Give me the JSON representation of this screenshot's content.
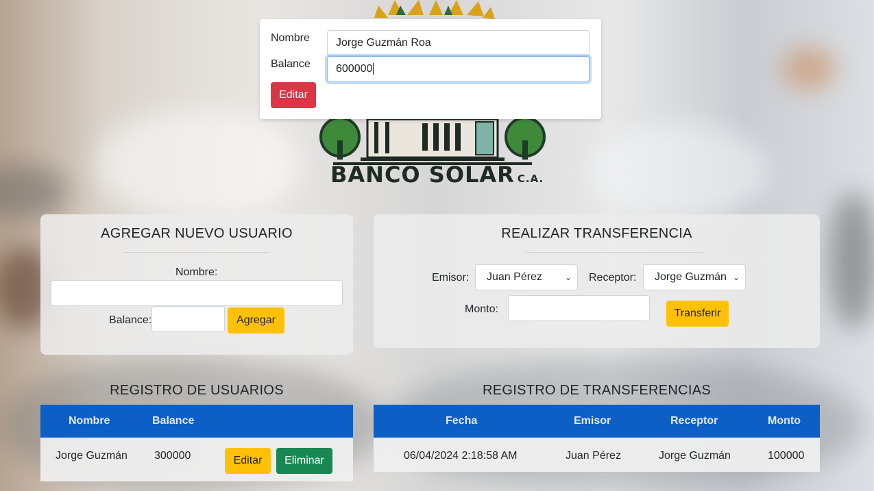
{
  "brand": {
    "logo_text": "BANCO SOLAR",
    "logo_suffix": "C.A."
  },
  "edit_modal": {
    "name_label": "Nombre",
    "name_value": "Jorge Guzmán Roa",
    "balance_label": "Balance",
    "balance_value": "600000",
    "submit_label": "Editar"
  },
  "add_user": {
    "title": "AGREGAR NUEVO USUARIO",
    "name_label": "Nombre:",
    "balance_label": "Balance:",
    "submit_label": "Agregar"
  },
  "transfer": {
    "title": "REALIZAR TRANSFERENCIA",
    "sender_label": "Emisor:",
    "sender_selected": "Juan Pérez",
    "receiver_label": "Receptor:",
    "receiver_selected": "Jorge Guzmán",
    "amount_label": "Monto:",
    "submit_label": "Transferir"
  },
  "users_table": {
    "title": "REGISTRO DE USUARIOS",
    "headers": [
      "Nombre",
      "Balance"
    ],
    "rows": [
      {
        "name": "Jorge Guzmán",
        "balance": "300000",
        "edit_label": "Editar",
        "delete_label": "Eliminar"
      }
    ]
  },
  "transfers_table": {
    "title": "REGISTRO DE TRANSFERENCIAS",
    "headers": [
      "Fecha",
      "Emisor",
      "Receptor",
      "Monto"
    ],
    "rows": [
      {
        "date": "06/04/2024 2:18:58 AM",
        "sender": "Juan Pérez",
        "receiver": "Jorge Guzmán",
        "amount": "100000"
      }
    ]
  },
  "colors": {
    "primary_header": "#0d5fc6",
    "warning": "#ffc107",
    "danger": "#dc3545",
    "success": "#198754"
  }
}
